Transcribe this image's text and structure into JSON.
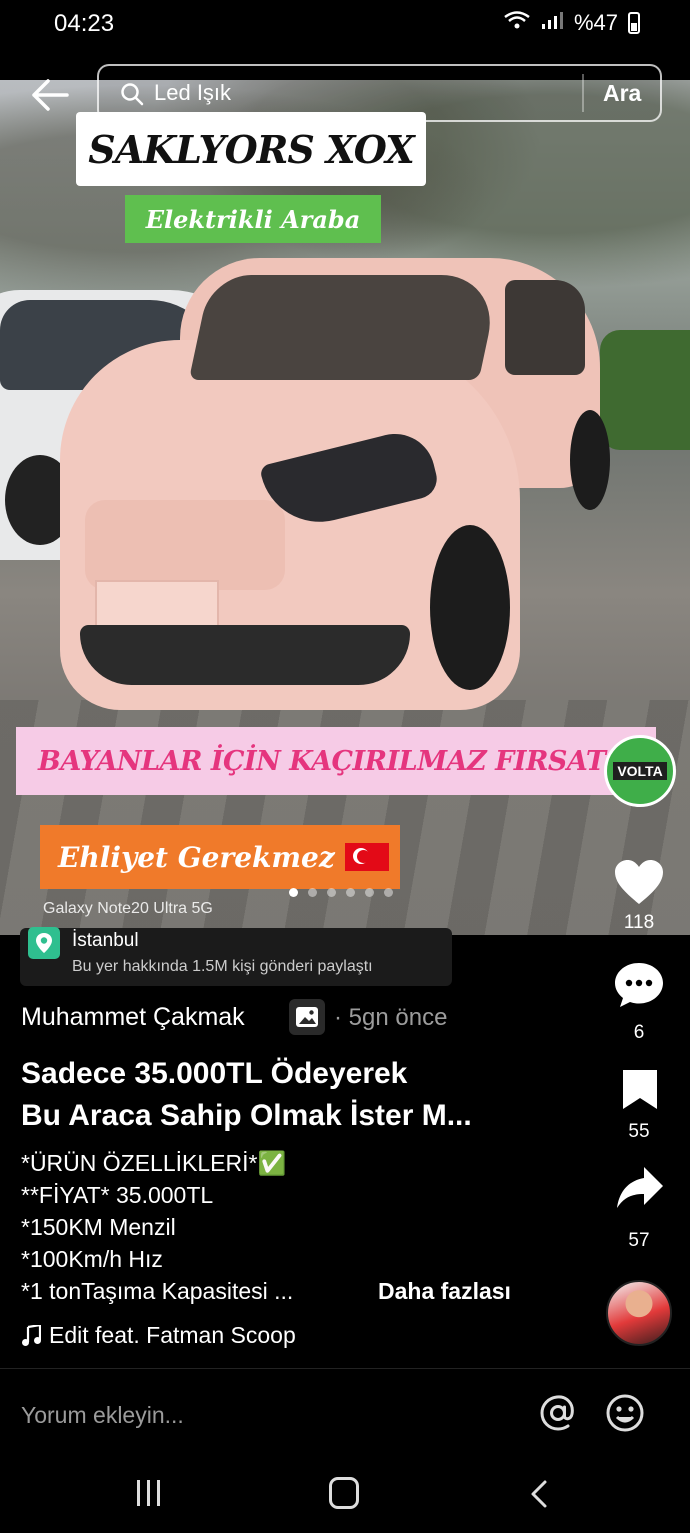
{
  "status_bar": {
    "time": "04:23",
    "battery": "%47"
  },
  "search": {
    "query": "Led Işık",
    "button_label": "Ara"
  },
  "post_overlay": {
    "title": "SAKLYORS XOX",
    "subtitle": "Elektrikli Araba",
    "offer_banner": "BAYANLAR İÇİN KAÇIRILMAZ FIRSAT",
    "brand_logo_text": "VOLTA",
    "license_banner": "Ehliyet Gerekmez",
    "device_label": "Galaxy Note20 Ultra 5G",
    "image_count": 6,
    "active_image": 1
  },
  "location": {
    "name": "İstanbul",
    "sub": "Bu yer hakkında 1.5M kişi gönderi paylaştı"
  },
  "actions": {
    "likes": "118",
    "comments": "6",
    "saves": "55",
    "shares": "57"
  },
  "post": {
    "author": "Muhammet Çakmak",
    "time_ago": "· 5gn önce",
    "headline_line1": "Sadece 35.000TL Ödeyerek",
    "headline_line2": "Bu Araca Sahip Olmak İster M...",
    "desc": [
      "*ÜRÜN ÖZELLİKLERİ*✅",
      "**FİYAT* 35.000TL",
      "*150KM Menzil",
      "*100Km/h Hız",
      "*1 tonTaşıma Kapasitesi ..."
    ],
    "more_label": "Daha fazlası",
    "music": "Edit feat. Fatman Scoop"
  },
  "comment_bar": {
    "placeholder": "Yorum ekleyin..."
  },
  "colors": {
    "like_icon": "#ffffff",
    "green_banner": "#5fbf4f",
    "pink_banner": "#f6cbe6",
    "pink_text": "#e5357e",
    "orange_banner": "#f07a2a",
    "location_pin": "#2fbf8f"
  },
  "icons": [
    "back-arrow-icon",
    "search-icon",
    "heart-icon",
    "comment-icon",
    "bookmark-icon",
    "share-icon",
    "location-pin-icon",
    "music-note-icon",
    "at-icon",
    "emoji-icon",
    "image-icon"
  ]
}
